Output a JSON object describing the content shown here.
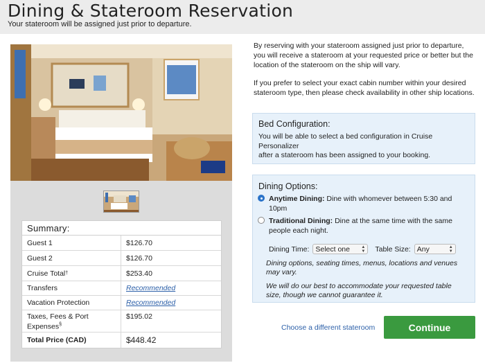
{
  "header": {
    "title": "Dining & Stateroom Reservation",
    "subtitle": "Your stateroom will be assigned just prior to departure."
  },
  "summary": {
    "title": "Summary:",
    "rows": [
      {
        "label": "Guest 1",
        "value": "$126.70"
      },
      {
        "label": "Guest 2",
        "value": "$126.70"
      },
      {
        "label": "Cruise Total",
        "label_sup": "†",
        "value": "$253.40"
      },
      {
        "label": "Transfers",
        "value": "Recommended"
      },
      {
        "label": "Vacation Protection",
        "value": "Recommended"
      },
      {
        "label": "Taxes, Fees & Port Expenses",
        "label_sup": "§",
        "value": "$195.02"
      },
      {
        "label": "Total Price (CAD)",
        "value": "$448.42"
      }
    ]
  },
  "intro": {
    "para1": "By reserving with your stateroom assigned just prior to departure, you will receive a stateroom at your requested price or better but the location of the stateroom on the ship will vary.",
    "para2": "If you prefer to select your exact cabin number within your desired stateroom type, then please check availability in other ship locations."
  },
  "bed": {
    "title": "Bed Configuration:",
    "line1": "You will be able to select a bed configuration in Cruise Personalizer",
    "line2": "after a stateroom has been assigned to your booking."
  },
  "dining": {
    "title": "Dining Options:",
    "anytime_label": "Anytime Dining:",
    "anytime_desc": "Dine with whomever between 5:30 and 10pm",
    "traditional_label": "Traditional Dining:",
    "traditional_desc": "Dine at the same time with the same people each night.",
    "dining_time_label": "Dining Time:",
    "dining_time_value": "Select one",
    "table_size_label": "Table Size:",
    "table_size_value": "Any",
    "note1": "Dining options, seating times, menus, locations and venues may vary.",
    "note2": "We will do our best to accommodate your requested table size, though we cannot guarantee it."
  },
  "actions": {
    "choose_link": "Choose a different stateroom",
    "continue": "Continue"
  },
  "colors": {
    "continue_bg": "#3a9a3f",
    "link": "#2b5fa8",
    "info_box": "#e7f1fa"
  }
}
